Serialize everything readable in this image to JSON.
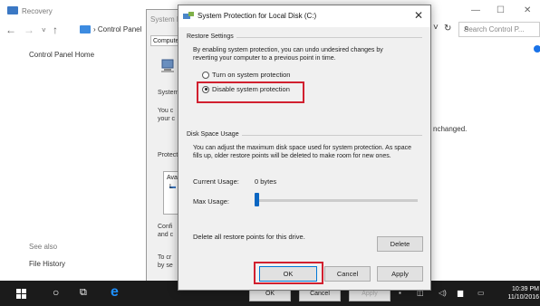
{
  "recovery_window": {
    "title": "Recovery",
    "breadcrumb": "Control Panel",
    "search_placeholder": "Search Control P...",
    "sidebar_home": "Control Panel Home",
    "see_also": "See also",
    "file_history": "File History",
    "body_fragment": "nchanged."
  },
  "system_properties": {
    "title": "System P",
    "tab": "Compute",
    "frag_system": "System",
    "frag_you1": "You c",
    "frag_you2": "your c",
    "frag_protect": "Protecti",
    "list_item1": "Avai",
    "list_item2": "L",
    "frag_conf1": "Confi",
    "frag_conf2": "and c",
    "frag_to1": "To cr",
    "frag_to2": "by se",
    "btn_ok": "OK",
    "btn_cancel": "Cancel",
    "btn_apply": "Apply"
  },
  "dialog": {
    "title": "System Protection for Local Disk (C:)",
    "close": "✕",
    "restore_group": "Restore Settings",
    "restore_desc_1": "By enabling system protection, you can undo undesired changes by",
    "restore_desc_2": "reverting your computer to a previous point in time.",
    "option_on": "Turn on system protection",
    "option_off": "Disable system protection",
    "selected_option": "option_off",
    "disk_group": "Disk Space Usage",
    "disk_desc_1": "You can adjust the maximum disk space used for system protection. As space",
    "disk_desc_2": "fills up, older restore points will be deleted to make room for new ones.",
    "current_usage_label": "Current Usage:",
    "current_usage_value": "0 bytes",
    "max_usage_label": "Max Usage:",
    "max_usage_fraction": 0.0,
    "delete_desc": "Delete all restore points for this drive.",
    "delete_button": "Delete",
    "ok_button": "OK",
    "cancel_button": "Cancel",
    "apply_button": "Apply",
    "highlight_color": "#d1202f"
  },
  "taskbar": {
    "time": "10:39 PM",
    "date": "11/10/2016"
  }
}
